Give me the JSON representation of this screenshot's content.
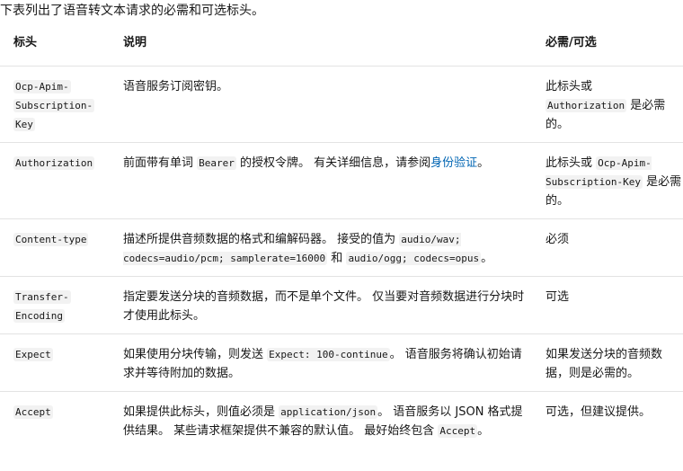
{
  "intro": "下表列出了语音转文本请求的必需和可选标头。",
  "table": {
    "headers": [
      "标头",
      "说明",
      "必需/可选"
    ],
    "rows": [
      {
        "header_code": [
          "Ocp-Apim-",
          "Subscription-",
          "Key"
        ],
        "desc": {
          "t1": "语音服务订阅密钥。"
        },
        "req": {
          "t1": "此标头或",
          "code1": "Authorization",
          "t2": " 是必需的。"
        }
      },
      {
        "header_code": [
          "Authorization"
        ],
        "desc": {
          "t1": "前面带有单词 ",
          "code1": "Bearer",
          "t2": " 的授权令牌。 有关详细信息，请参阅",
          "link": "身份验证",
          "t3": "。"
        },
        "req": {
          "t1": "此标头或 ",
          "code1": "Ocp-Apim-Subscription-Key",
          "t2": " 是必需的。"
        }
      },
      {
        "header_code": [
          "Content-type"
        ],
        "desc": {
          "t1": "描述所提供音频数据的格式和编解码器。 接受的值为 ",
          "code1": "audio/wav; codecs=audio/pcm; samplerate=16000",
          "t2": " 和 ",
          "code2": "audio/ogg; codecs=opus",
          "t3": "。"
        },
        "req": {
          "t1": "必须"
        }
      },
      {
        "header_code": [
          "Transfer-",
          "Encoding"
        ],
        "desc": {
          "t1": "指定要发送分块的音频数据，而不是单个文件。 仅当要对音频数据进行分块时才使用此标头。"
        },
        "req": {
          "t1": "可选"
        }
      },
      {
        "header_code": [
          "Expect"
        ],
        "desc": {
          "t1": "如果使用分块传输，则发送 ",
          "code1": "Expect: 100-continue",
          "t2": "。 语音服务将确认初始请求并等待附加的数据。"
        },
        "req": {
          "t1": "如果发送分块的音频数据，则是必需的。"
        }
      },
      {
        "header_code": [
          "Accept"
        ],
        "desc": {
          "t1": "如果提供此标头，则值必须是 ",
          "code1": "application/json",
          "t2": "。 语音服务以 JSON 格式提供结果。 某些请求框架提供不兼容的默认值。 最好始终包含 ",
          "code2": "Accept",
          "t3": "。"
        },
        "req": {
          "t1": "可选，但建议提供。"
        }
      }
    ]
  }
}
